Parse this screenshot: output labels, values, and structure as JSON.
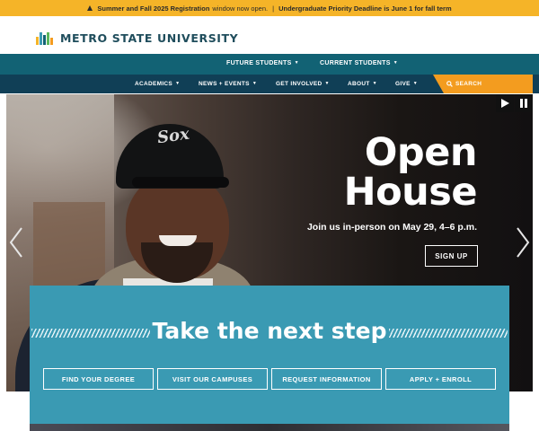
{
  "alert": {
    "highlight": "Summer and Fall 2025 Registration",
    "text": "window now open.",
    "separator": "|",
    "deadline": "Undergraduate Priority Deadline is June 1 for fall term"
  },
  "header": {
    "logo_text": "METRO STATE UNIVERSITY"
  },
  "nav_primary": [
    {
      "label": "FUTURE STUDENTS"
    },
    {
      "label": "CURRENT STUDENTS"
    }
  ],
  "nav_secondary": [
    {
      "label": "ACADEMICS"
    },
    {
      "label": "NEWS + EVENTS"
    },
    {
      "label": "GET INVOLVED"
    },
    {
      "label": "ABOUT"
    },
    {
      "label": "GIVE"
    }
  ],
  "search": {
    "label": "SEARCH"
  },
  "hero": {
    "title_line1": "Open",
    "title_line2": "House",
    "subtitle": "Join us in-person on May 29, 4–6 p.m.",
    "cta": "SIGN UP",
    "cap_logo": "Sox"
  },
  "next_step": {
    "title": "Take the next step",
    "buttons": [
      {
        "label": "FIND YOUR DEGREE"
      },
      {
        "label": "VISIT OUR CAMPUSES"
      },
      {
        "label": "REQUEST INFORMATION"
      },
      {
        "label": "APPLY + ENROLL"
      }
    ]
  },
  "colors": {
    "alert_bg": "#f5b428",
    "nav_primary_bg": "#126274",
    "nav_secondary_bg": "#103f56",
    "search_bg": "#f39c1f",
    "step_bg": "#3a9ab3",
    "logo_text": "#1f4d5c"
  },
  "icons": {
    "alert": "warning-icon",
    "search": "search-icon",
    "play": "play-icon",
    "pause": "pause-icon",
    "prev": "chevron-left-icon",
    "next": "chevron-right-icon"
  }
}
